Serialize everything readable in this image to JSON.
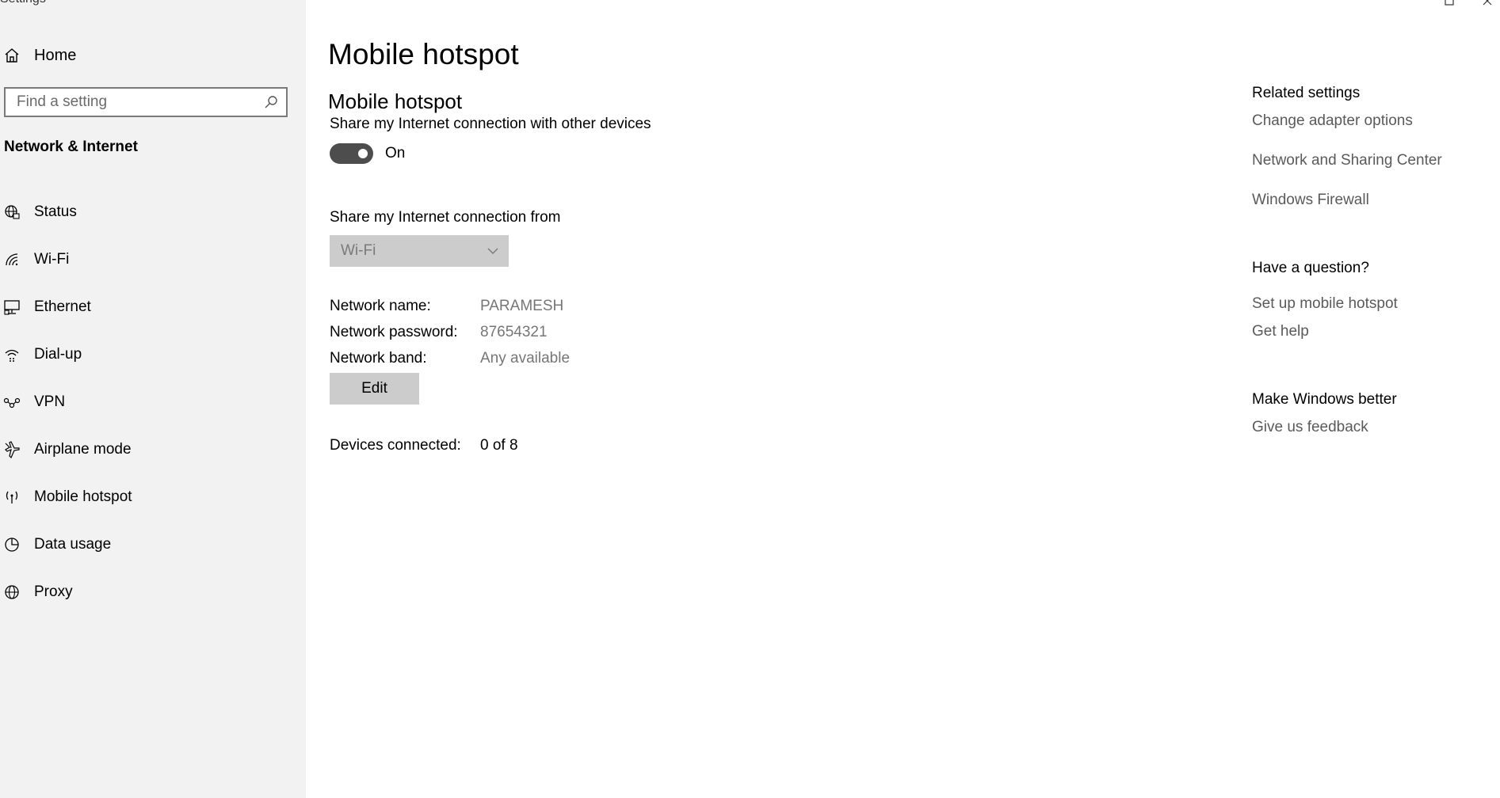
{
  "window": {
    "app_title": "Settings"
  },
  "sidebar": {
    "home_label": "Home",
    "search_placeholder": "Find a setting",
    "section_title": "Network & Internet",
    "items": [
      {
        "label": "Status",
        "icon": "globe-status-icon"
      },
      {
        "label": "Wi-Fi",
        "icon": "wifi-icon"
      },
      {
        "label": "Ethernet",
        "icon": "ethernet-icon"
      },
      {
        "label": "Dial-up",
        "icon": "dialup-icon"
      },
      {
        "label": "VPN",
        "icon": "vpn-icon"
      },
      {
        "label": "Airplane mode",
        "icon": "airplane-icon"
      },
      {
        "label": "Mobile hotspot",
        "icon": "hotspot-icon",
        "selected": true
      },
      {
        "label": "Data usage",
        "icon": "data-usage-icon"
      },
      {
        "label": "Proxy",
        "icon": "globe-icon"
      }
    ]
  },
  "main": {
    "page_title": "Mobile hotspot",
    "sub_heading": "Mobile hotspot",
    "share_desc": "Share my Internet connection with other devices",
    "toggle_state": "On",
    "from_label": "Share my Internet connection from",
    "from_value": "Wi-Fi",
    "network_name_label": "Network name:",
    "network_name": "PARAMESH",
    "network_password_label": "Network password:",
    "network_password": "87654321",
    "network_band_label": "Network band:",
    "network_band": "Any available",
    "edit_label": "Edit",
    "devices_label": "Devices connected:",
    "devices_value": "0 of 8"
  },
  "right": {
    "related_title": "Related settings",
    "related_links": [
      "Change adapter options",
      "Network and Sharing Center",
      "Windows Firewall"
    ],
    "question_title": "Have a question?",
    "question_links": [
      "Set up mobile hotspot",
      "Get help"
    ],
    "better_title": "Make Windows better",
    "feedback_link": "Give us feedback"
  },
  "colors": {
    "sidebar_bg": "#f2f2f2",
    "toggle_on": "#4d4d4d",
    "control_gray": "#cccccc",
    "link_gray": "#5a5a5a"
  }
}
